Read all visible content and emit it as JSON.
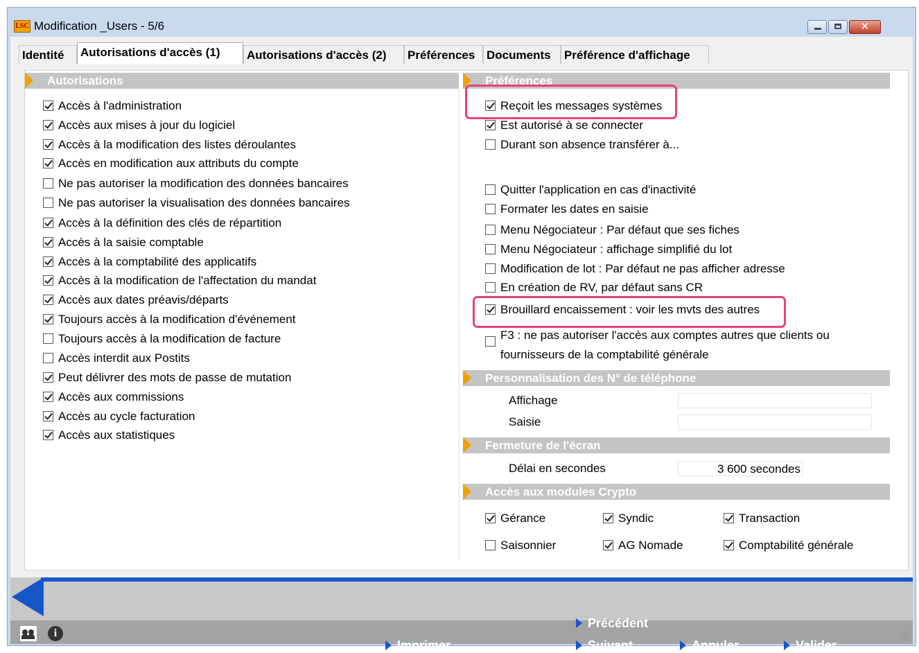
{
  "window": {
    "logo": "LSC",
    "title": "Modification _Users - 5/6",
    "close_glyph": "✕"
  },
  "tabs": [
    {
      "label": "Identité"
    },
    {
      "label": "Autorisations d'accès (1)"
    },
    {
      "label": "Autorisations d'accès (2)"
    },
    {
      "label": "Préférences"
    },
    {
      "label": "Documents"
    },
    {
      "label": "Préférence d'affichage"
    }
  ],
  "autorisations": {
    "title": "Autorisations",
    "items": [
      {
        "label": "Accès à l'administration",
        "checked": true
      },
      {
        "label": "Accès aux mises à jour du logiciel",
        "checked": true
      },
      {
        "label": "Accès à la modification des listes déroulantes",
        "checked": true
      },
      {
        "label": "Accès en modification aux attributs du compte",
        "checked": true
      },
      {
        "label": "Ne pas autoriser la modification des données bancaires",
        "checked": false
      },
      {
        "label": "Ne pas autoriser la visualisation des données bancaires",
        "checked": false
      },
      {
        "label": "Accès à la définition des clés de répartition",
        "checked": true
      },
      {
        "label": "Accès à la saisie comptable",
        "checked": true
      },
      {
        "label": "Accès à la comptabilité des applicatifs",
        "checked": true
      },
      {
        "label": "Accès à la modification de l'affectation du mandat",
        "checked": true
      },
      {
        "label": "Accès aux dates préavis/départs",
        "checked": true
      },
      {
        "label": "Toujours accès à la modification d'événement",
        "checked": true
      },
      {
        "label": "Toujours accès à la modification de facture",
        "checked": false
      },
      {
        "label": "Accès interdit aux Postits",
        "checked": false
      },
      {
        "label": "Peut délivrer des mots de passe de mutation",
        "checked": true
      },
      {
        "label": "Accès aux commissions",
        "checked": true
      },
      {
        "label": "Accès au cycle facturation",
        "checked": true
      },
      {
        "label": "Accès aux statistiques",
        "checked": true
      }
    ]
  },
  "preferences": {
    "title": "Préférences",
    "items": [
      {
        "label": "Reçoit les messages systèmes",
        "checked": true
      },
      {
        "label": "Est autorisé à se connecter",
        "checked": true
      },
      {
        "label": "Durant son absence transférer à...",
        "checked": false
      },
      {
        "label": "Quitter l'application en cas d'inactivité",
        "checked": false
      },
      {
        "label": "Formater les dates en saisie",
        "checked": false
      },
      {
        "label": "Menu Négociateur : Par défaut que ses fiches",
        "checked": false
      },
      {
        "label": "Menu Négociateur : affichage simplifié du lot",
        "checked": false
      },
      {
        "label": "Modification de lot : Par défaut ne pas afficher adresse",
        "checked": false
      },
      {
        "label": "En création de RV, par défaut sans CR",
        "checked": false
      },
      {
        "label": "Brouillard encaissement : voir les mvts des autres",
        "checked": true
      },
      {
        "label": "F3 : ne pas autoriser l'accès aux comptes autres que clients ou",
        "label2": "fournisseurs de la comptabilité générale",
        "checked": false
      }
    ]
  },
  "telephone": {
    "title": "Personnalisation des N° de téléphone",
    "affichage_label": "Affichage",
    "affichage_value": "",
    "saisie_label": "Saisie",
    "saisie_value": ""
  },
  "fermeture": {
    "title": "Fermeture de l'écran",
    "delai_label": "Délai en secondes",
    "delai_value": "3 600 secondes"
  },
  "crypto": {
    "title": "Accès aux modules Crypto",
    "items": [
      {
        "label": "Gérance",
        "checked": true
      },
      {
        "label": "Syndic",
        "checked": true
      },
      {
        "label": "Transaction",
        "checked": true
      },
      {
        "label": "Saisonnier",
        "checked": false
      },
      {
        "label": "AG Nomade",
        "checked": true
      },
      {
        "label": "Comptabilité générale",
        "checked": true
      }
    ]
  },
  "actions": {
    "precedent": "Précédent",
    "imprimer": "Imprimer",
    "suivant": "Suivant",
    "annuler": "Annuler",
    "valider": "Valider",
    "info_glyph": "i"
  },
  "colors": {
    "accent_blue": "#1657c8",
    "section_arrow": "#f0a000",
    "highlight": "#e8407a",
    "section_header": "#c4c4c4"
  }
}
